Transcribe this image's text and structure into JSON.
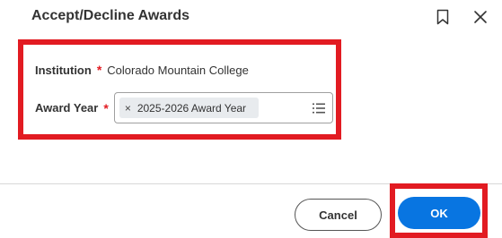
{
  "dialog": {
    "title": "Accept/Decline Awards",
    "icons": {
      "bookmark": "bookmark-icon",
      "close": "close-icon"
    }
  },
  "form": {
    "institution": {
      "label": "Institution",
      "required_mark": "*",
      "value": "Colorado Mountain College"
    },
    "award_year": {
      "label": "Award Year",
      "required_mark": "*",
      "selected": "2025-2026 Award Year",
      "remove_glyph": "×",
      "list_icon": "list-icon"
    }
  },
  "footer": {
    "cancel_label": "Cancel",
    "ok_label": "OK"
  },
  "colors": {
    "highlight": "#e21b22",
    "primary": "#0875e1",
    "required": "#e21b22",
    "pill_bg": "#e8ebee"
  }
}
